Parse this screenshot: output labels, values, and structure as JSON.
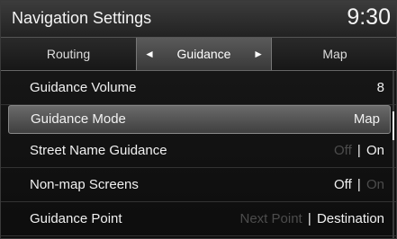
{
  "header": {
    "title": "Navigation Settings",
    "clock": "9:30"
  },
  "tabs": {
    "routing": "Routing",
    "guidance": "Guidance",
    "map": "Map",
    "arrow_left": "◄",
    "arrow_right": "►"
  },
  "settings": [
    {
      "label": "Guidance Volume",
      "value": "8"
    },
    {
      "label": "Guidance Mode",
      "value": "Map"
    },
    {
      "label": "Street Name Guidance",
      "option_off": "Off",
      "separator": "|",
      "option_on": "On",
      "selected": "On"
    },
    {
      "label": "Non-map Screens",
      "option_off": "Off",
      "separator": "|",
      "option_on": "On",
      "selected": "Off"
    },
    {
      "label": "Guidance Point",
      "option_a": "Next Point",
      "separator": "|",
      "option_b": "Destination",
      "selected": "Destination"
    }
  ]
}
